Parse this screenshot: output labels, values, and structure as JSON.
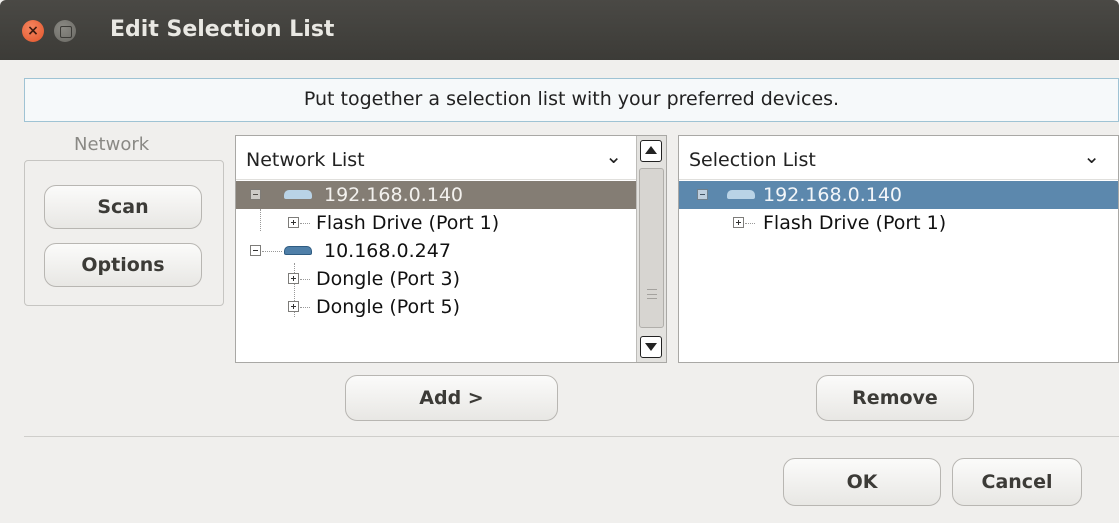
{
  "window": {
    "title": "Edit Selection List"
  },
  "banner": {
    "text": "Put together a selection list with your preferred devices."
  },
  "network_group": {
    "label": "Network",
    "scan_label": "Scan",
    "options_label": "Options"
  },
  "network_list": {
    "header": "Network List",
    "items": [
      {
        "label": "192.168.0.140",
        "kind": "host",
        "expanded": true,
        "selected": true
      },
      {
        "label": "Flash Drive (Port 1)",
        "kind": "device"
      },
      {
        "label": "10.168.0.247",
        "kind": "host",
        "expanded": true,
        "selected": false
      },
      {
        "label": "Dongle (Port 3)",
        "kind": "device"
      },
      {
        "label": "Dongle (Port 5)",
        "kind": "device"
      }
    ]
  },
  "selection_list": {
    "header": "Selection List",
    "items": [
      {
        "label": "192.168.0.140",
        "kind": "host",
        "expanded": true,
        "selected": true
      },
      {
        "label": "Flash Drive (Port 1)",
        "kind": "device"
      }
    ]
  },
  "buttons": {
    "add_label": "Add >",
    "remove_label": "Remove",
    "ok_label": "OK",
    "cancel_label": "Cancel"
  },
  "colors": {
    "titlebar": "#3c3b37",
    "close_button": "#e95420",
    "network_selection": "#847d74",
    "list_selection": "#5c88ad",
    "banner_border": "#9fc3d4"
  }
}
